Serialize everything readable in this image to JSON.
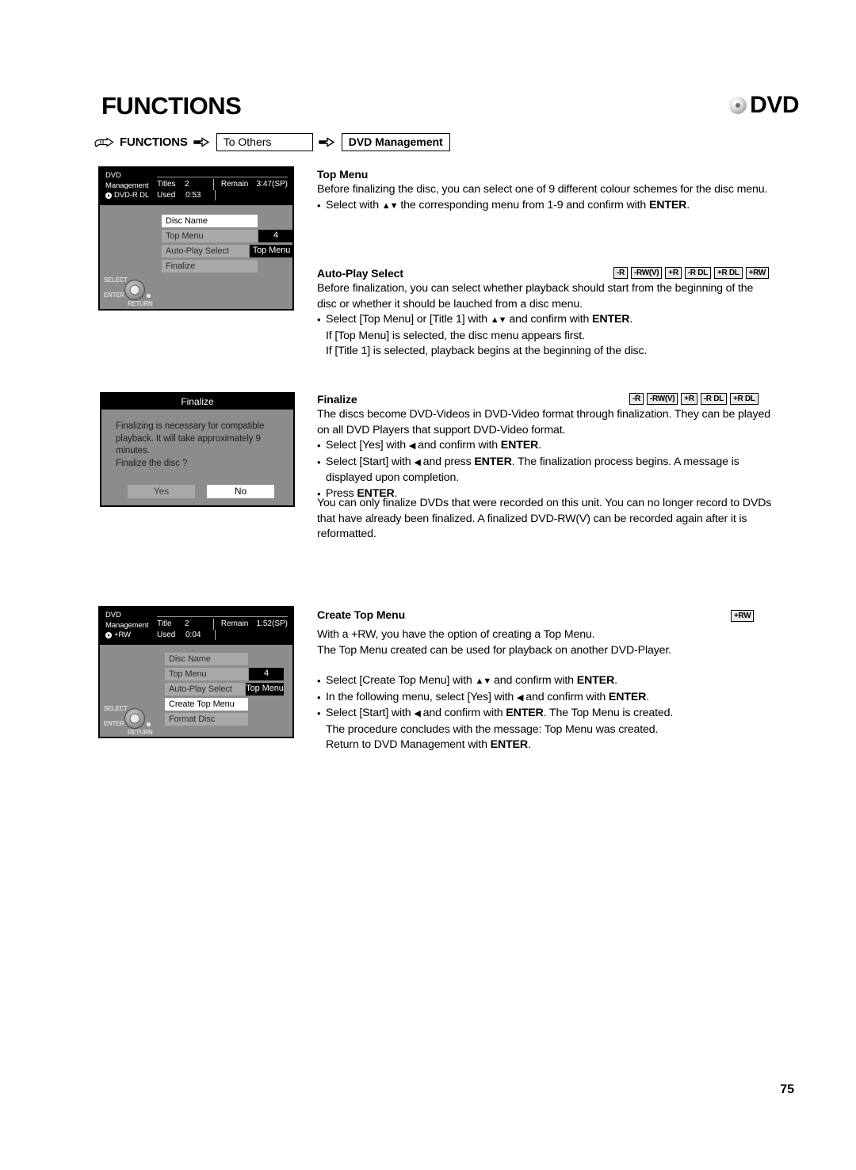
{
  "page": {
    "title": "FUNCTIONS",
    "logo_text": "DVD",
    "number": "75"
  },
  "breadcrumb": {
    "hand_icon": "pointing-hand-icon",
    "root": "FUNCTIONS",
    "arrow_icon": "arrow-right-icon",
    "step1": "To Others",
    "step2": "DVD Management"
  },
  "osd_screen_1": {
    "title_line1": "DVD",
    "title_line2": "Management",
    "disc_type": "DVD-R DL",
    "stats": {
      "titles_label": "Titles",
      "titles_value": "2",
      "used_label": "Used",
      "used_value": "0:53",
      "remain_label": "Remain",
      "remain_value": "3:47(SP)"
    },
    "rows": [
      {
        "label": "Disc Name",
        "value": "",
        "selected": true
      },
      {
        "label": "Top Menu",
        "value": "4",
        "selected": false
      },
      {
        "label": "Auto-Play Select",
        "value": "Top Menu",
        "selected": false
      },
      {
        "label": "Finalize",
        "value": "",
        "selected": false
      }
    ],
    "joystick": {
      "select": "SELECT",
      "enter": "ENTER",
      "return": "RETURN"
    }
  },
  "finalize_dialog": {
    "title": "Finalize",
    "message_line1": "Finalizing is necessary for compatible",
    "message_line2": "playback. It will take approximately 9 minutes.",
    "message_line3": "Finalize the disc ?",
    "yes_label": "Yes",
    "no_label": "No"
  },
  "osd_screen_2": {
    "title_line1": "DVD",
    "title_line2": "Management",
    "disc_type": "+RW",
    "stats": {
      "titles_label": "Title",
      "titles_value": "2",
      "used_label": "Used",
      "used_value": "0:04",
      "remain_label": "Remain",
      "remain_value": "1:52(SP)"
    },
    "rows": [
      {
        "label": "Disc Name",
        "value": "",
        "selected": false
      },
      {
        "label": "Top Menu",
        "value": "4",
        "selected": false
      },
      {
        "label": "Auto-Play Select",
        "value": "Top Menu",
        "selected": false
      },
      {
        "label": "Create Top Menu",
        "value": "",
        "selected": true
      },
      {
        "label": "Format Disc",
        "value": "",
        "selected": false
      }
    ],
    "joystick": {
      "select": "SELECT",
      "enter": "ENTER",
      "return": "RETURN"
    }
  },
  "sections": {
    "top_menu": {
      "heading": "Top Menu",
      "p1": "Before finalizing the disc, you can select one of 9 different colour schemes for the disc menu.",
      "bullet1_pre": "Select with ",
      "bullet1_arrows": "▲▼",
      "bullet1_mid": " the corresponding menu from 1-9 and confirm with ",
      "bullet1_key": "ENTER",
      "bullet1_post": "."
    },
    "auto_play": {
      "heading": "Auto-Play Select",
      "badges": [
        "-R",
        "-RW(V)",
        "+R",
        "-R DL",
        "+R DL",
        "+RW"
      ],
      "p1": "Before finalization, you can select whether playback should start from the beginning of the disc or whether it should be lauched from a disc menu.",
      "bullet1_pre": "Select [Top Menu] or [Title 1] with ",
      "bullet1_arrows": "▲▼",
      "bullet1_mid": " and confirm with ",
      "bullet1_key": "ENTER",
      "bullet1_post": ".",
      "sub1": "If [Top Menu] is selected, the disc menu appears first.",
      "sub2": "If [Title 1] is selected, playback begins at the beginning of the disc."
    },
    "finalize": {
      "heading": "Finalize",
      "badges": [
        "-R",
        "-RW(V)",
        "+R",
        "-R DL",
        "+R DL"
      ],
      "p1": "The discs become DVD-Videos in DVD-Video format through finalization. They can be played on all DVD Players that support DVD-Video format.",
      "bullet1_pre": "Select [Yes] with ",
      "bullet1_arrow": "◀",
      "bullet1_mid": " and confirm with ",
      "bullet1_key": "ENTER",
      "bullet1_post": ".",
      "bullet2_pre": "Select [Start] with ",
      "bullet2_arrow": "◀",
      "bullet2_mid": " and press ",
      "bullet2_key": "ENTER",
      "bullet2_post": ". The finalization process begins. A message is displayed upon completion.",
      "bullet3_pre": "Press ",
      "bullet3_key": "ENTER",
      "bullet3_post": ".",
      "p2": "You can only finalize DVDs that were recorded on this unit. You can no longer record to DVDs that have already been finalized. A finalized DVD-RW(V) can be recorded again after it is reformatted."
    },
    "create_top_menu": {
      "heading": "Create Top Menu",
      "badges": [
        "+RW"
      ],
      "p1": "With a +RW, you have the option of creating a Top Menu.",
      "p2": "The Top Menu created can be used for playback on another DVD-Player.",
      "bullet1_pre": "Select [Create Top Menu] with ",
      "bullet1_arrows": "▲▼",
      "bullet1_mid": " and confirm with ",
      "bullet1_key": "ENTER",
      "bullet1_post": ".",
      "bullet2_pre": "In the following menu, select [Yes] with ",
      "bullet2_arrow": "◀",
      "bullet2_mid": " and confirm with ",
      "bullet2_key": "ENTER",
      "bullet2_post": ".",
      "bullet3_pre": "Select [Start] with ",
      "bullet3_arrow": "◀",
      "bullet3_mid": " and confirm with ",
      "bullet3_key": "ENTER",
      "bullet3_post": ". The Top Menu is created.",
      "sub1": "The procedure concludes with the message: Top Menu was created.",
      "sub2_pre": "Return to DVD Management with ",
      "sub2_key": "ENTER",
      "sub2_post": "."
    }
  },
  "bullet_char": "•"
}
